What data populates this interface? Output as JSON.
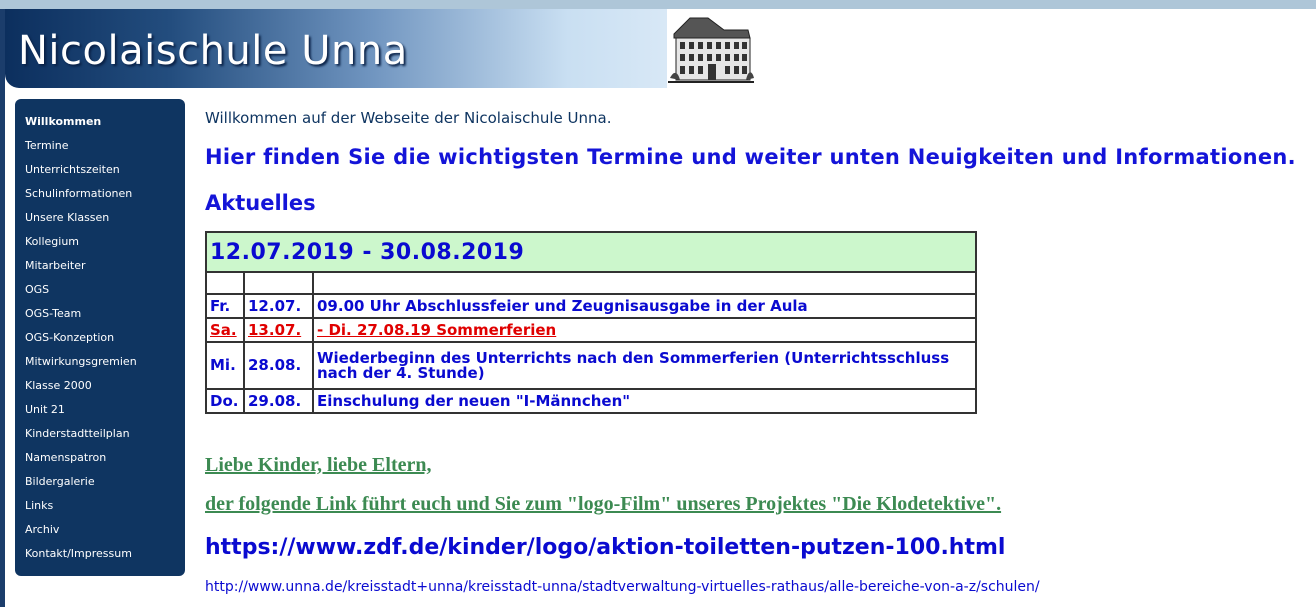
{
  "header": {
    "title": "Nicolaischule Unna"
  },
  "sidebar": {
    "items": [
      {
        "label": "Willkommen",
        "active": true
      },
      {
        "label": "Termine"
      },
      {
        "label": "Unterrichtszeiten"
      },
      {
        "label": "Schulinformationen"
      },
      {
        "label": "Unsere Klassen"
      },
      {
        "label": "Kollegium"
      },
      {
        "label": "Mitarbeiter"
      },
      {
        "label": "OGS"
      },
      {
        "label": "OGS-Team"
      },
      {
        "label": "OGS-Konzeption"
      },
      {
        "label": "Mitwirkungsgremien"
      },
      {
        "label": "Klasse 2000"
      },
      {
        "label": "Unit 21"
      },
      {
        "label": "Kinderstadtteilplan"
      },
      {
        "label": "Namenspatron"
      },
      {
        "label": "Bildergalerie"
      },
      {
        "label": "Links"
      },
      {
        "label": "Archiv"
      },
      {
        "label": "Kontakt/Impressum"
      }
    ]
  },
  "main": {
    "welcome": "Willkommen auf der Webseite der Nicolaischule Unna.",
    "headline": "Hier finden Sie die wichtigsten Termine und weiter unten Neuigkeiten und Informationen.",
    "aktuelles": "Aktuelles",
    "events": {
      "range": "12.07.2019 - 30.08.2019",
      "rows": [
        {
          "day": "Fr.",
          "date": "12.07.",
          "text": "09.00 Uhr Abschlussfeier und Zeugnisausgabe in der Aula"
        },
        {
          "day": "Sa.",
          "date": "13.07.",
          "text": "- Di. 27.08.19 Sommerferien"
        },
        {
          "day": "Mi.",
          "date": "28.08.",
          "text": "Wiederbeginn des Unterrichts nach den Sommerferien (Unterrichtsschluss nach der 4. Stunde)"
        },
        {
          "day": "Do.",
          "date": "29.08.",
          "text": "Einschulung der neuen \"I-Männchen\""
        }
      ]
    },
    "greeting": "Liebe Kinder, liebe Eltern,",
    "info": "der folgende Link führt euch und Sie zum \"logo-Film\" unseres Projektes \"Die Klodetektive\".",
    "link_zdf": "https://www.zdf.de/kinder/logo/aktion-toiletten-putzen-100.html",
    "link_unna": "http://www.unna.de/kreisstadt+unna/kreisstadt-unna/stadtverwaltung-virtuelles-rathaus/alle-bereiche-von-a-z/schulen/"
  },
  "colors": {
    "sidebar_bg": "#0f3561",
    "link_blue": "#0a0ad0",
    "headline_blue": "#1414d8",
    "holiday_red": "#e00000",
    "range_green": "#ccf7cc",
    "text_green": "#3c8a52"
  }
}
